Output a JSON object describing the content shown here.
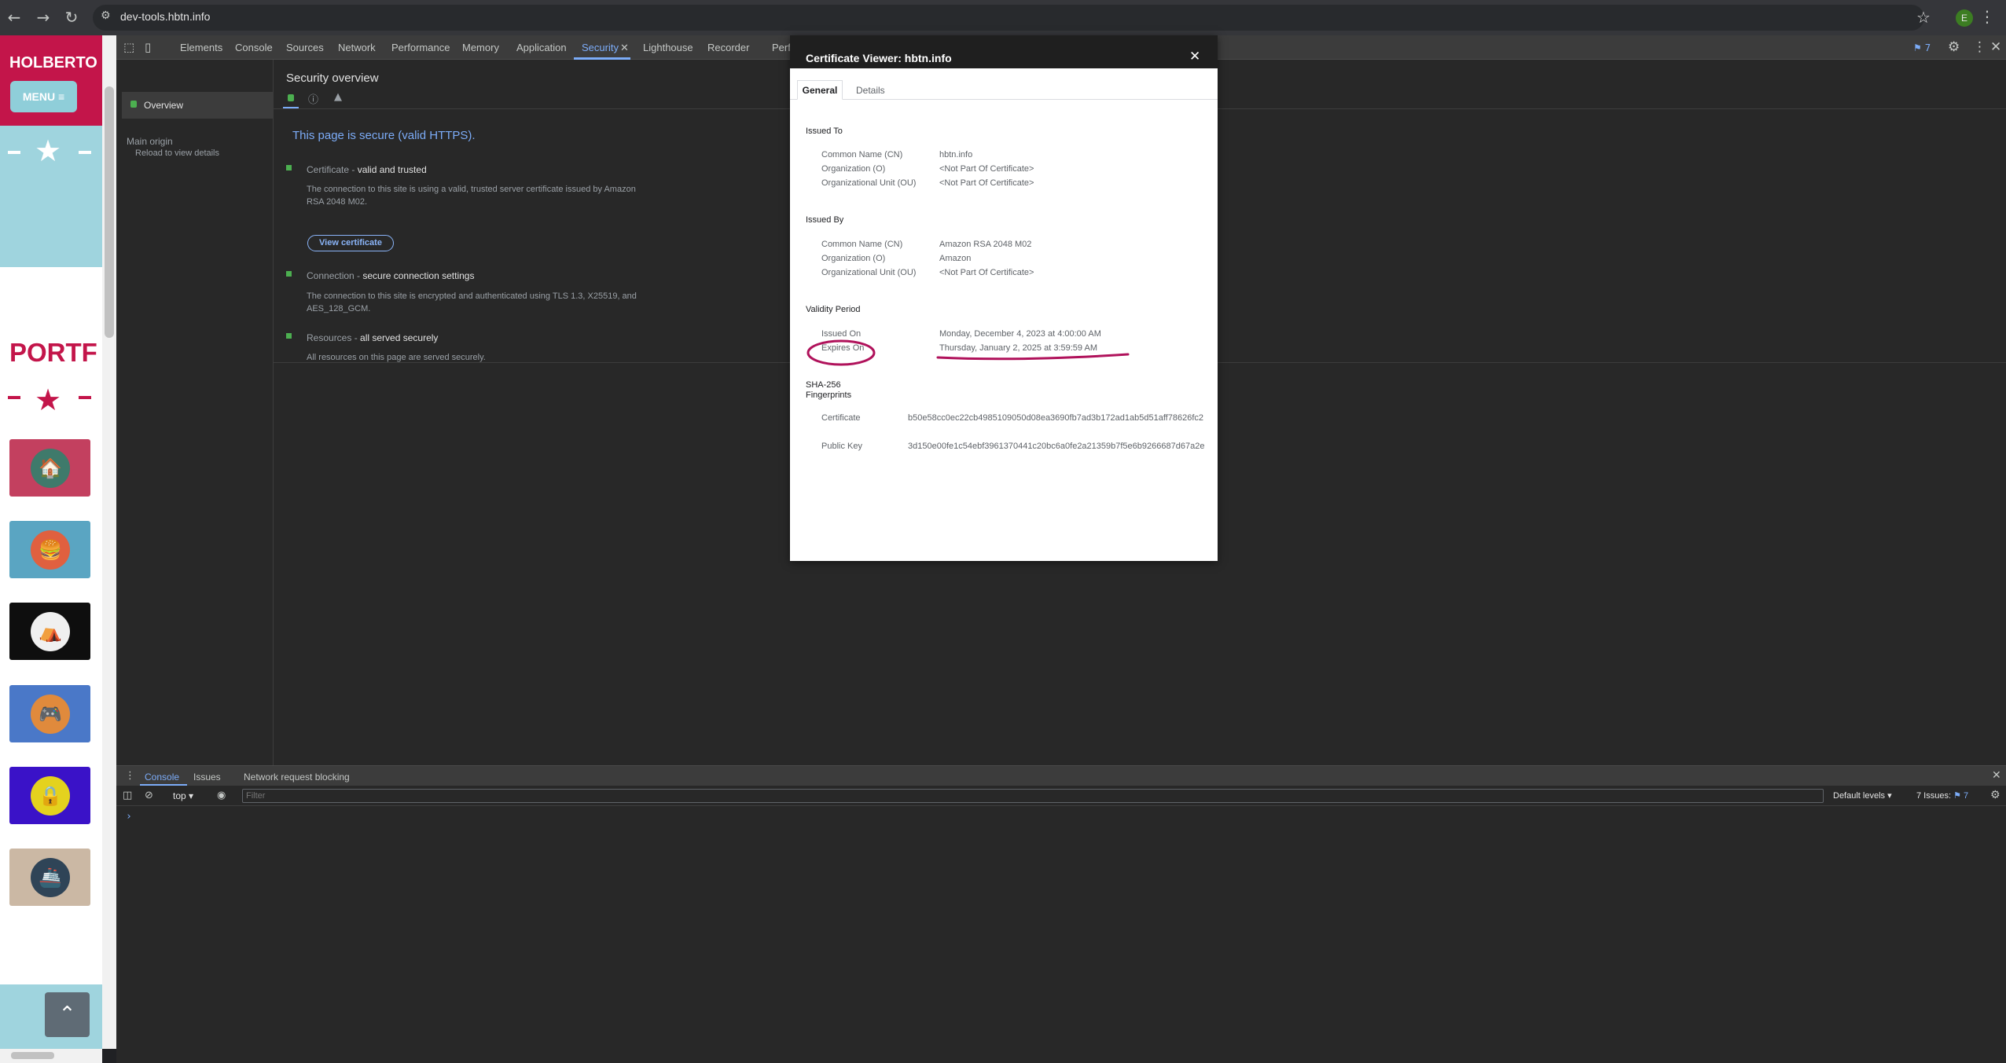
{
  "browser": {
    "url": "dev-tools.hbtn.info",
    "profile_initial": "E"
  },
  "page": {
    "brand": "HOLBERTO",
    "menu_label": "MENU ≡",
    "portfolio_title": "PORTF",
    "scroll_top_glyph": "⌃"
  },
  "devtools": {
    "tabs": [
      "Elements",
      "Console",
      "Sources",
      "Network",
      "Performance",
      "Memory",
      "Application",
      "Security",
      "Lighthouse",
      "Recorder",
      "Perf"
    ],
    "active_tab": "Security",
    "issues_badge": "7",
    "sidebar": {
      "overview": "Overview",
      "main_origin": "Main origin",
      "reload": "Reload to view details"
    },
    "security": {
      "title": "Security overview",
      "headline": "This page is secure (valid HTTPS).",
      "certificate_label": "Certificate - ",
      "certificate_status": "valid and trusted",
      "certificate_desc": "The connection to this site is using a valid, trusted server certificate issued by Amazon RSA 2048 M02.",
      "view_certificate": "View certificate",
      "connection_label": "Connection - ",
      "connection_status": "secure connection settings",
      "connection_desc": "The connection to this site is encrypted and authenticated using TLS 1.3, X25519, and AES_128_GCM.",
      "resources_label": "Resources - ",
      "resources_status": "all served securely",
      "resources_desc": "All resources on this page are served securely."
    },
    "drawer": {
      "tabs": [
        "Console",
        "Issues",
        "Network request blocking"
      ],
      "context": "top ▾",
      "filter_placeholder": "Filter",
      "levels": "Default levels ▾",
      "issues_text": "7 Issues: ",
      "issues_num": "⚑ 7",
      "prompt": "›"
    }
  },
  "certificate_viewer": {
    "title": "Certificate Viewer: hbtn.info",
    "tabs": {
      "general": "General",
      "details": "Details"
    },
    "issued_to": {
      "heading": "Issued To",
      "cn_label": "Common Name (CN)",
      "cn": "hbtn.info",
      "o_label": "Organization (O)",
      "o": "<Not Part Of Certificate>",
      "ou_label": "Organizational Unit (OU)",
      "ou": "<Not Part Of Certificate>"
    },
    "issued_by": {
      "heading": "Issued By",
      "cn_label": "Common Name (CN)",
      "cn": "Amazon RSA 2048 M02",
      "o_label": "Organization (O)",
      "o": "Amazon",
      "ou_label": "Organizational Unit (OU)",
      "ou": "<Not Part Of Certificate>"
    },
    "validity": {
      "heading": "Validity Period",
      "issued_on_label": "Issued On",
      "issued_on": "Monday, December 4, 2023 at 4:00:00 AM",
      "expires_on_label": "Expires On",
      "expires_on": "Thursday, January 2, 2025 at 3:59:59 AM"
    },
    "fingerprints": {
      "heading_line1": "SHA-256",
      "heading_line2": "Fingerprints",
      "certificate_label": "Certificate",
      "certificate": "b50e58cc0ec22cb4985109050d08ea3690fb7ad3b172ad1ab5d51aff78626fc2",
      "public_key_label": "Public Key",
      "public_key": "3d150e00fe1c54ebf3961370441c20bc6a0fe2a21359b7f5e6b9266687d67a2e"
    }
  },
  "colors": {
    "annotation": "#b0125b",
    "accent": "#7cacf8",
    "secure_green": "#4caf50",
    "brand_red": "#c3154a"
  }
}
